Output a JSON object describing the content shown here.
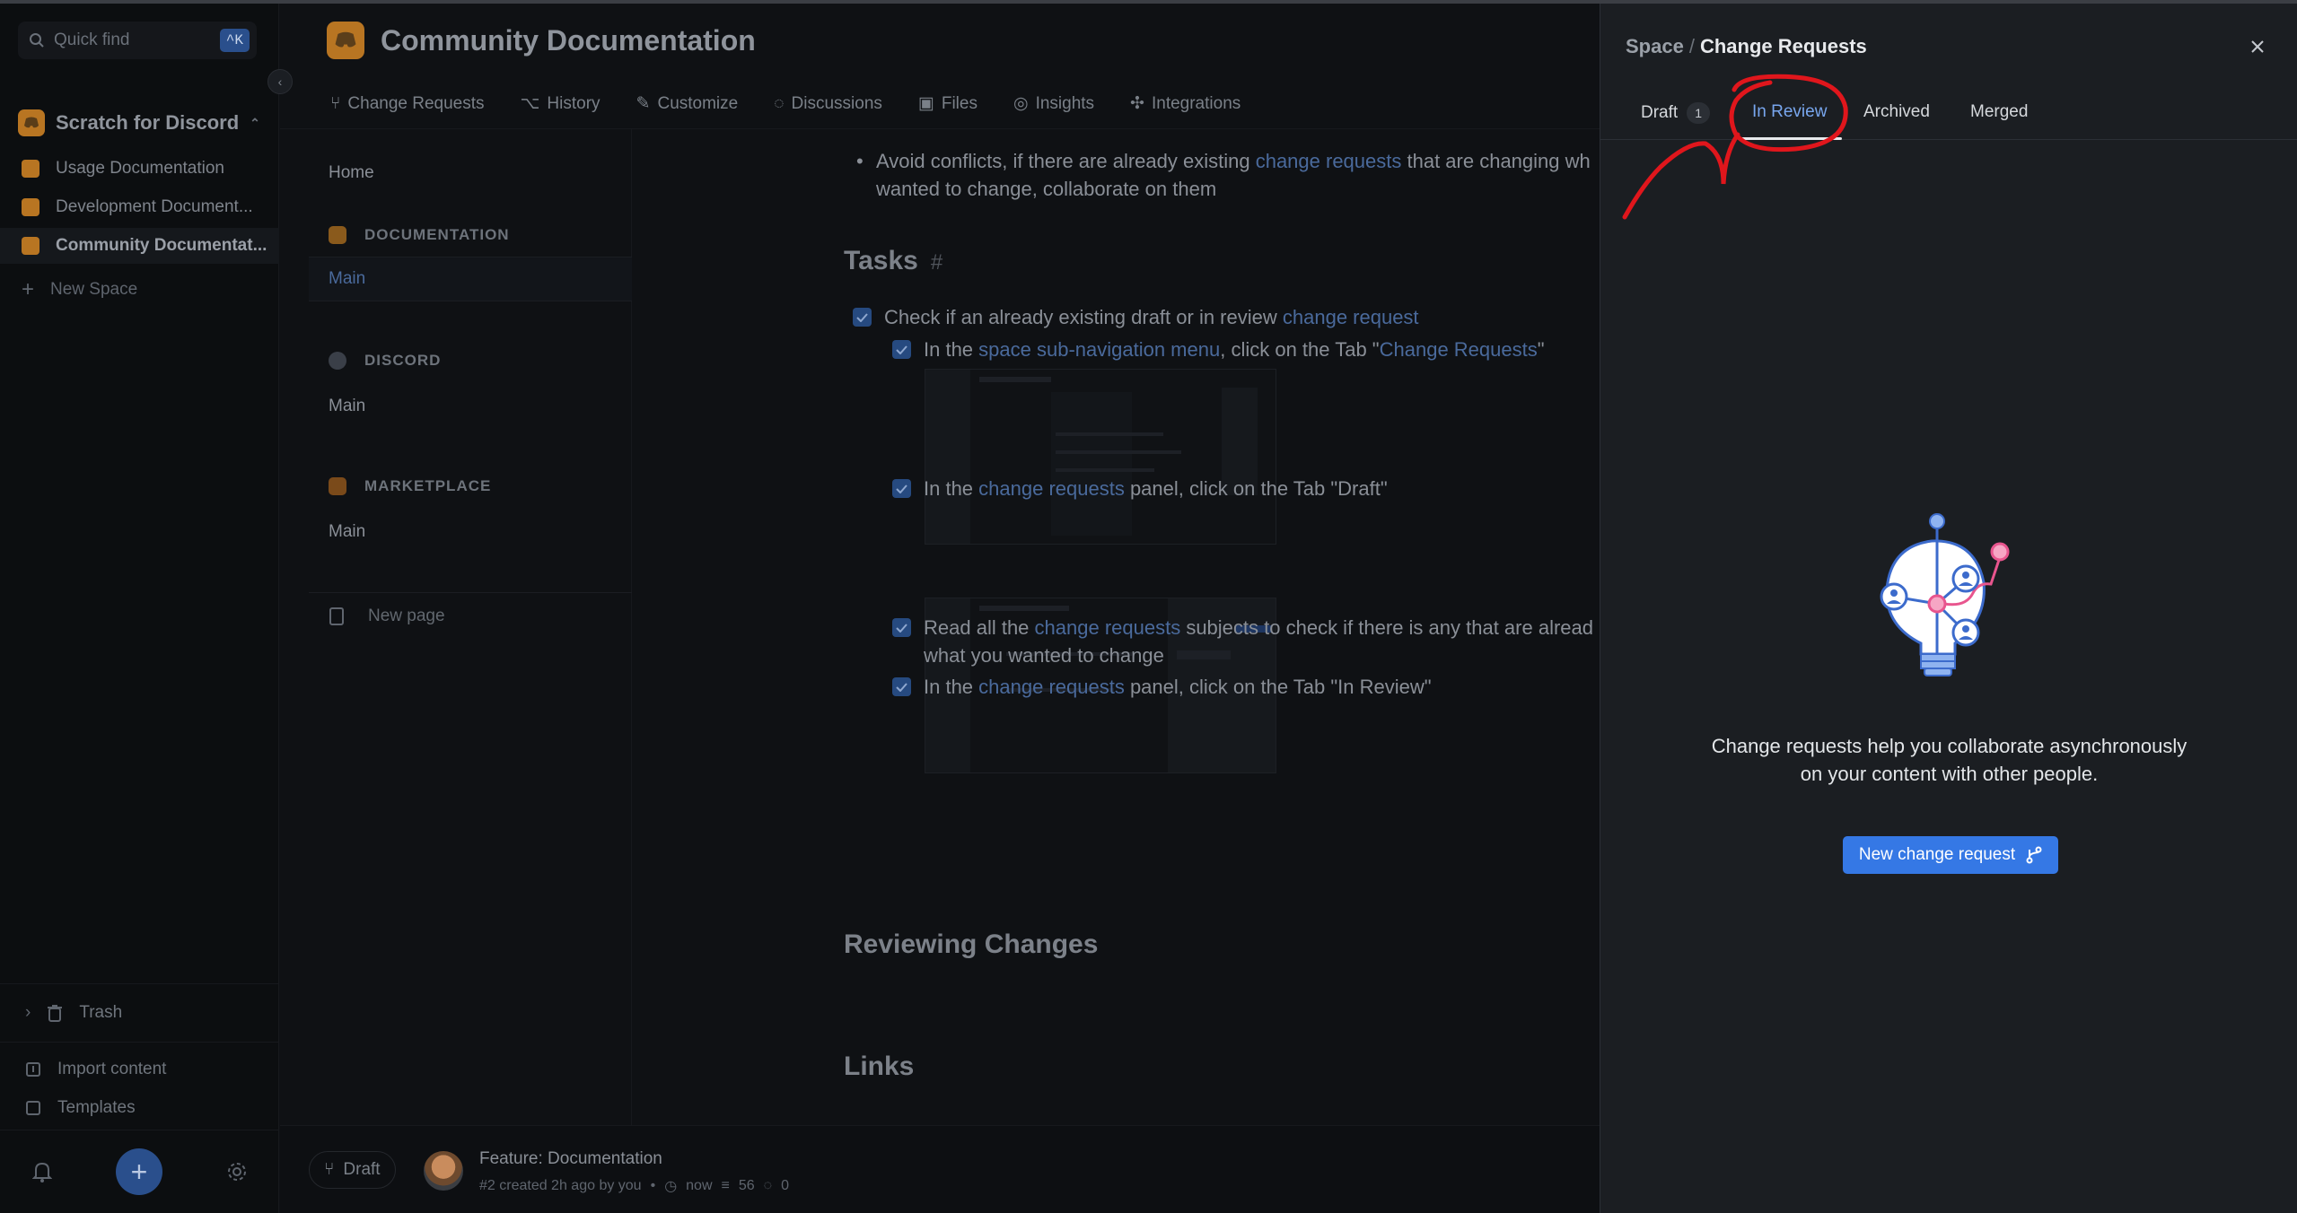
{
  "sidebar": {
    "quick_find": "Quick find",
    "shortcut": "^K",
    "org_name": "Scratch for Discord",
    "spaces": [
      "Usage Documentation",
      "Development Document...",
      "Community Documentat..."
    ],
    "new_space": "New Space",
    "trash": "Trash",
    "import_content": "Import content",
    "templates": "Templates"
  },
  "header": {
    "space_title": "Community Documentation",
    "subnav": [
      "Change Requests",
      "History",
      "Customize",
      "Discussions",
      "Files",
      "Insights",
      "Integrations"
    ]
  },
  "pages": {
    "home": "Home",
    "groups": [
      {
        "title": "DOCUMENTATION",
        "page": "Main",
        "color": "#8a5a1c"
      },
      {
        "title": "DISCORD",
        "page": "Main",
        "color": "#3a3f48"
      },
      {
        "title": "MARKETPLACE",
        "page": "Main",
        "color": "#7a4a1a"
      }
    ],
    "new_page": "New page"
  },
  "doc": {
    "bullet_pre": "Avoid conflicts, if there are already existing ",
    "bullet_link": "change requests",
    "bullet_post": " that are changing wh",
    "bullet_line2": "wanted to change, collaborate on them",
    "tasks_heading": "Tasks",
    "task1_pre": "Check if an already existing draft or in review ",
    "task1_link": "change request",
    "task2_pre": "In the ",
    "task2_link": "space sub-navigation menu",
    "task2_mid": ", click on the Tab \"",
    "task2_link2": "Change Requests",
    "task2_post": "\"",
    "task3_pre": "In the ",
    "task3_link": "change requests",
    "task3_post": " panel, click on the Tab \"Draft\"",
    "task4_pre": "Read all the ",
    "task4_link": "change requests",
    "task4_post": " subjects to check if there is any that are alread",
    "task4_line2": "what you wanted to change",
    "task5_pre": "In the ",
    "task5_link": "change requests",
    "task5_post": " panel, click on the Tab \"In Review\"",
    "reviewing_heading": "Reviewing Changes",
    "links_heading": "Links"
  },
  "footer": {
    "draft_label": "Draft",
    "cr_title": "Feature: Documentation",
    "cr_meta": "#2 created 2h ago by you",
    "time": "now",
    "lines": "56",
    "comments": "0"
  },
  "panel": {
    "crumb_space": "Space",
    "crumb_sep": "/",
    "crumb_title": "Change Requests",
    "tabs": [
      {
        "label": "Draft",
        "count": "1"
      },
      {
        "label": "In Review"
      },
      {
        "label": "Archived"
      },
      {
        "label": "Merged"
      }
    ],
    "active_tab": "In Review",
    "empty_line1": "Change requests help you collaborate asynchronously",
    "empty_line2": "on your content with other people.",
    "new_button": "New change request"
  },
  "colors": {
    "accent": "#3578e5",
    "active_tab": "#78a6ee",
    "annotation": "#e0161c",
    "illustration_blue": "#3c6bcc",
    "illustration_pink": "#e8558e"
  }
}
